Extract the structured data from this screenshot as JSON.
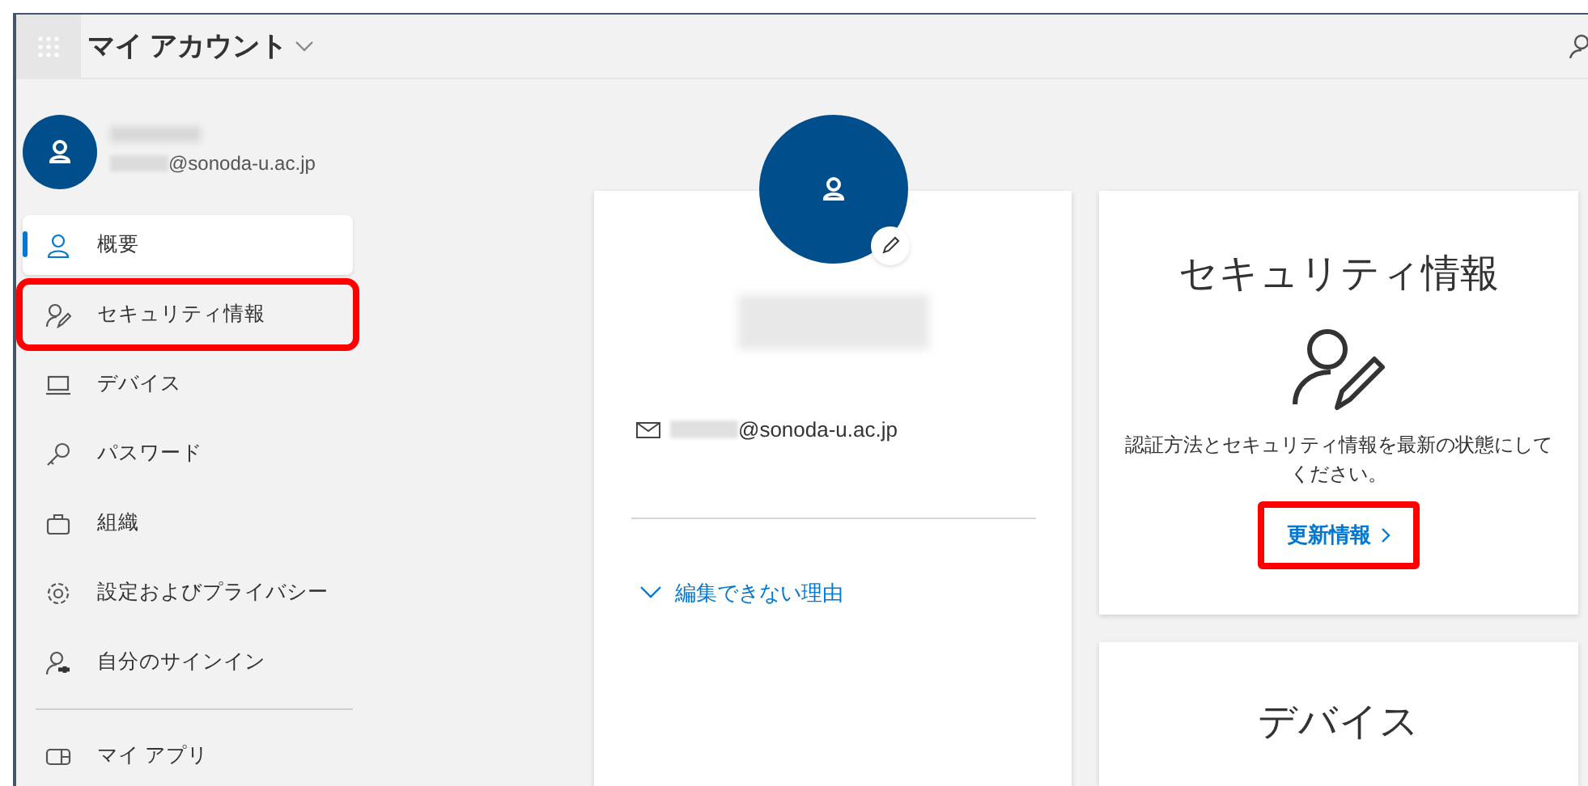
{
  "header": {
    "title": "マイ アカウント"
  },
  "account": {
    "email_domain": "@sonoda-u.ac.jp"
  },
  "sidebar": {
    "items": [
      {
        "label": "概要",
        "selected": true,
        "highlighted": false
      },
      {
        "label": "セキュリティ情報",
        "selected": false,
        "highlighted": true
      },
      {
        "label": "デバイス",
        "selected": false,
        "highlighted": false
      },
      {
        "label": "パスワード",
        "selected": false,
        "highlighted": false
      },
      {
        "label": "組織",
        "selected": false,
        "highlighted": false
      },
      {
        "label": "設定およびプライバシー",
        "selected": false,
        "highlighted": false
      },
      {
        "label": "自分のサインイン",
        "selected": false,
        "highlighted": false
      },
      {
        "label": "マイ アプリ",
        "selected": false,
        "highlighted": false
      }
    ]
  },
  "profile_card": {
    "email_domain": "@sonoda-u.ac.jp",
    "expander": "編集できない理由"
  },
  "security_card": {
    "title": "セキュリティ情報",
    "description": "認証方法とセキュリティ情報を最新の状態にしてください。",
    "link": "更新情報",
    "link_highlighted": true
  },
  "devices_card": {
    "title": "デバイス"
  }
}
